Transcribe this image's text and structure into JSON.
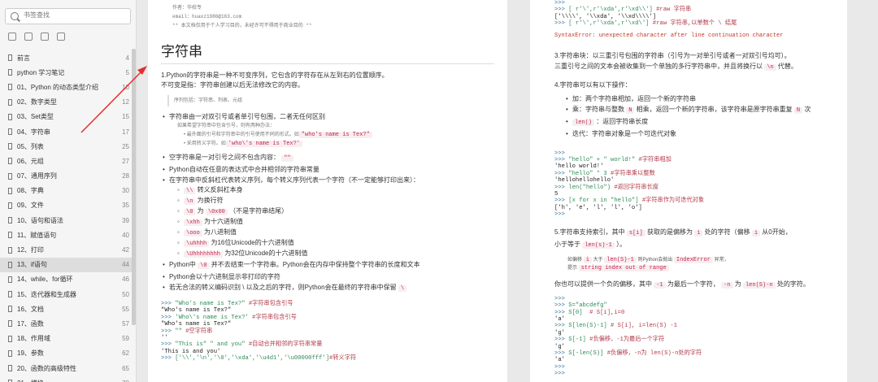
{
  "sidebar": {
    "search_placeholder": "书签查找",
    "items": [
      {
        "label": "前言",
        "page": "4"
      },
      {
        "label": "python 学习笔记",
        "page": "5"
      },
      {
        "label": "01、Python 的动态类型介绍",
        "page": "10"
      },
      {
        "label": "02、数字类型",
        "page": "12"
      },
      {
        "label": "03、Set类型",
        "page": "15"
      },
      {
        "label": "04、字符串",
        "page": "17"
      },
      {
        "label": "05、列表",
        "page": "25"
      },
      {
        "label": "06、元组",
        "page": "27"
      },
      {
        "label": "07、通用序列",
        "page": "28"
      },
      {
        "label": "08、字典",
        "page": "30"
      },
      {
        "label": "09、文件",
        "page": "35"
      },
      {
        "label": "10、语句和语法",
        "page": "39"
      },
      {
        "label": "11、赋值语句",
        "page": "40"
      },
      {
        "label": "12、打印",
        "page": "42"
      },
      {
        "label": "13、if语句",
        "page": "44"
      },
      {
        "label": "14、while、for循环",
        "page": "46"
      },
      {
        "label": "15、迭代器和生成器",
        "page": "50"
      },
      {
        "label": "16、文档",
        "page": "55"
      },
      {
        "label": "17、函数",
        "page": "57"
      },
      {
        "label": "18、作用域",
        "page": "59"
      },
      {
        "label": "19、参数",
        "page": "62"
      },
      {
        "label": "20、函数的高级特性",
        "page": "65"
      },
      {
        "label": "21、模块",
        "page": "70"
      }
    ]
  },
  "page1": {
    "header_lines": [
      "作者：华校专",
      "email：huaxz1986@163.com",
      "**  本文档仅用于个人学习目的，未经许可不得用于商业目的  **"
    ],
    "title": "字符串",
    "intro1": "1.Python的字符串是一种不可变序列，它包含的字符存在从左到右的位置顺序。",
    "intro2": "不可变是指：字符串创建以后无法修改它的内容。",
    "note": "序列包括：字符串、列表、元组",
    "b1": "字符串由一对双引号或者单引号包围，二者无任何区别",
    "b1_sub": "如果希望字符串中包含引号，则有两种办法：",
    "b1_sub_a": "最外面的引号和字符串中的引号使用不同的形式。如",
    "b1_sub_a_code": "\"who's name is Tex?\"",
    "b1_sub_b": "采用转义字符。如",
    "b1_sub_b_code": "'who\\'s name is Tex?'",
    "b2": "空字符串是一对引号之间不包含内容：",
    "b2_code": "\"\"",
    "b3": "Python自动在任意的表达式中合并相邻的字符串常量",
    "b4": "在字符串中反斜杠代表转义序列，每个转义序列代表一个字符（不一定能够打印出来）：",
    "escapes": [
      {
        "code": "\\\\",
        "desc": "转义反斜杠本身"
      },
      {
        "code": "\\n",
        "desc": "为换行符"
      },
      {
        "code": "\\0",
        "desc": "为",
        "code2": "\\0x00",
        "desc2": "（不是字符串结尾）"
      },
      {
        "code": "\\xhh",
        "desc": "为十六进制值"
      },
      {
        "code": "\\ooo",
        "desc": "为八进制值"
      },
      {
        "code": "\\uhhhh",
        "desc": "为16位Unicode的十六进制值"
      },
      {
        "code": "\\Uhhhhhhhh",
        "desc": "为32位Unicode的十六进制值"
      }
    ],
    "b5a": "Python中",
    "b5_code": "\\0",
    "b5b": "并不去结束一个字符串。Python会在内存中保持整个字符串的长度和文本",
    "b6": "Python会以十六进制显示非打印的字符",
    "b7a": "若无合法的转义编码识别",
    "b7b": "以及之后的字符，则Python会在最终的字符串中保留",
    "b7_code": "\\",
    "code_lines": [
      {
        "p": ">>> ",
        "s": "\"Who's name is Tex?\"",
        "c": " #字符串包含引号"
      },
      {
        "o": "\"Who's name is Tex?\""
      },
      {
        "p": ">>> ",
        "s": "'Who\\'s name is Tex?'",
        "c": " #字符串包含引号"
      },
      {
        "o": "\"Who's name is Tex?\""
      },
      {
        "p": ">>> ",
        "s": "\"\"",
        "c": " #空字符串"
      },
      {
        "o": "''"
      },
      {
        "p": ">>> ",
        "s": "\"This is\" \" and you\"",
        "c": " #自动合并相邻的字符串常量"
      },
      {
        "o": "'This is and you'"
      },
      {
        "p": ">>> ",
        "s": "['\\\\','\\n','\\0','\\xda','\\u4d1','\\u00000fff']",
        "c": "#转义字符"
      }
    ]
  },
  "page2": {
    "code_top": [
      {
        "p": ">>>"
      },
      {
        "p": ">>> ",
        "s": "[ r'\\',r'\\xda',r'\\xd\\\\']",
        "c": " #raw 字符串"
      },
      {
        "o": "['\\\\\\\\', '\\\\xda', '\\\\xd\\\\\\\\']"
      },
      {
        "p": ">>> ",
        "s": "[ r'\\',r'\\xda',r'\\xd\\']",
        "c": " #raw 字符串,以单数个 \\ 结尾"
      }
    ],
    "error": "SyntaxError: unexpected character after line continuation character",
    "s3a": "3.字符串块：以三重引号包围的字符串（引号为一对单引号或者一对双引号均可）。",
    "s3b": "三重引号之间的文本会被收集到一个单独的多行字符串中，并且将换行以",
    "s3_code": "\\n",
    "s3c": "代替。",
    "s4": "4.字符串可以有以下操作：",
    "ops": [
      {
        "a": "加：两个字符串相加，返回一个新的字符串"
      },
      {
        "a": "乘：字符串与整数",
        "code": "N",
        "b": "相乘，返回一个新的字符串，该字符串是原字符串重复",
        "code2": "N",
        "b2": "次"
      },
      {
        "code": "len()",
        "b": "：返回字符串长度"
      },
      {
        "a": "迭代：字符串对象是一个可迭代对象"
      }
    ],
    "code_mid": [
      {
        "p": ">>>"
      },
      {
        "p": ">>> ",
        "s": "\"hello\" + \" world!\"",
        "c": " #字符串相加"
      },
      {
        "o": "'hello world!'"
      },
      {
        "p": ">>> ",
        "s": "\"hello\" * 3",
        "c": " #字符串乘以整数"
      },
      {
        "o": "'hellohellohello'"
      },
      {
        "p": ">>> ",
        "s": "len(\"hello\")",
        "c": " #返回字符串长度"
      },
      {
        "o": "5"
      },
      {
        "p": ">>> ",
        "s": "[x for x in \"hello\"]",
        "c": " #字符串作为可迭代对象"
      },
      {
        "o": "['h', 'e', 'l', 'l', 'o']"
      },
      {
        "p": ">>>"
      }
    ],
    "s5a": "5.字符串支持索引，其中",
    "s5_code1": "s[i]",
    "s5b": "获取的是偏移为",
    "s5_code2": "i",
    "s5c": "处的字符（偏移",
    "s5_code3": "i",
    "s5d": "从0开始，",
    "s5e": "小于等于",
    "s5_code4": "len(s)-1",
    "s5f": "）。",
    "note_a": "如偏移",
    "note_code1": "i",
    "note_b": "大于",
    "note_code2": "len(S)-1",
    "note_c": "则Python会抛出",
    "note_code3": "IndexError",
    "note_d": "异常，",
    "note_e": "提示",
    "note_code4": "string index out of range",
    "s6a": "你也可以提供一个负的偏移，其中",
    "s6_code1": "-1",
    "s6b": "为最后一个字符，",
    "s6_code2": "-n",
    "s6c": "为",
    "s6_code3": "len(S)-n",
    "s6d": "处的字符。",
    "code_bot": [
      {
        "p": ">>>"
      },
      {
        "p": ">>> ",
        "s": "S=\"abcdefg\""
      },
      {
        "p": ">>> ",
        "s": "S[0]",
        "c": "  # S[i],i=0"
      },
      {
        "o": "'a'"
      },
      {
        "p": ">>> ",
        "s": "S[len(S)-1]",
        "c": " # S[i], i=len(S) -1"
      },
      {
        "o": "'g'"
      },
      {
        "p": ">>> ",
        "s": "S[-1]",
        "c": " #负偏移，-1为最后一个字符"
      },
      {
        "o": "'g'"
      },
      {
        "p": ">>> ",
        "s": "S[-len(S)]",
        "c": " #负偏移，-n为 len(S)-n处的字符"
      },
      {
        "o": "'a'"
      },
      {
        "p": ">>>"
      },
      {
        "p": ">>>"
      }
    ]
  },
  "colors": {
    "arrow": "#e03030",
    "active_item": "#dddddd"
  }
}
